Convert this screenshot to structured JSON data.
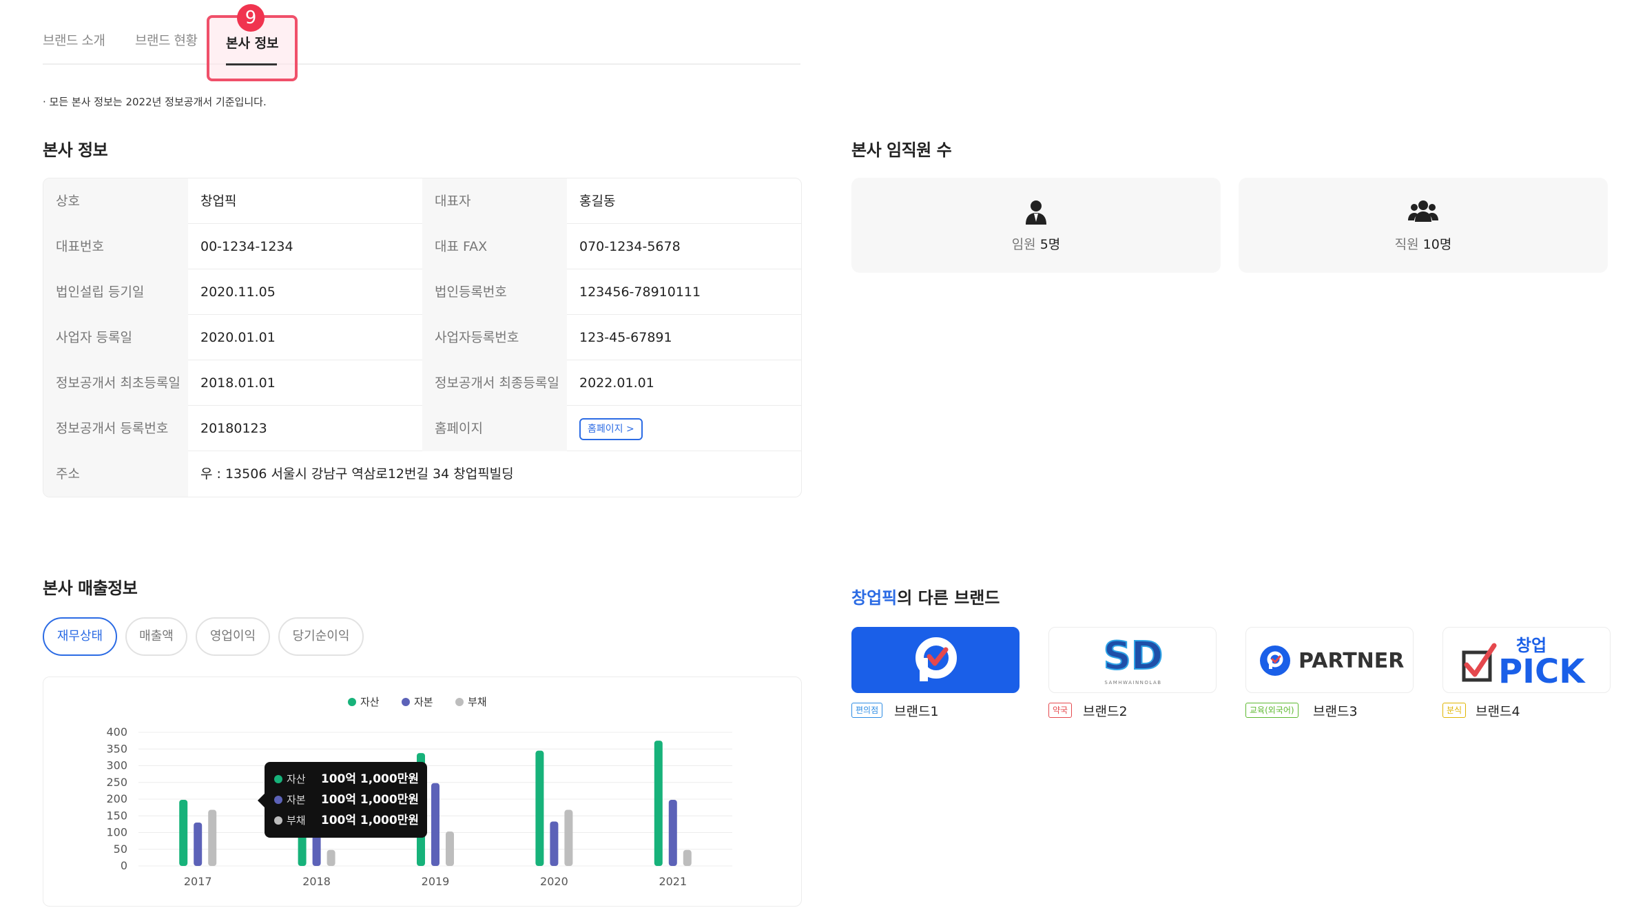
{
  "tabs": {
    "items": [
      {
        "label": "브랜드 소개"
      },
      {
        "label": "브랜드 현황"
      },
      {
        "label": "본사 정보"
      }
    ],
    "badge": "9"
  },
  "notice": "· 모든 본사 정보는 2022년 정보공개서 기준입니다.",
  "hq_info": {
    "title": "본사 정보",
    "rows": [
      {
        "label_a": "상호",
        "value_a": "창업픽",
        "label_b": "대표자",
        "value_b": "홍길동"
      },
      {
        "label_a": "대표번호",
        "value_a": "00-1234-1234",
        "label_b": "대표 FAX",
        "value_b": "070-1234-5678"
      },
      {
        "label_a": "법인설립 등기일",
        "value_a": "2020.11.05",
        "label_b": "법인등록번호",
        "value_b": "123456-78910111"
      },
      {
        "label_a": "사업자 등록일",
        "value_a": "2020.01.01",
        "label_b": "사업자등록번호",
        "value_b": "123-45-67891"
      },
      {
        "label_a": "정보공개서 최초등록일",
        "value_a": "2018.01.01",
        "label_b": "정보공개서 최종등록일",
        "value_b": "2022.01.01"
      },
      {
        "label_a": "정보공개서 등록번호",
        "value_a": "20180123",
        "label_b": "홈페이지",
        "value_b": "홈페이지 >"
      }
    ],
    "address_label": "주소",
    "address_value": "우 : 13506 서울시 강남구 역삼로12번길 34 창업픽빌딩"
  },
  "employees": {
    "title": "본사 임직원 수",
    "executives": {
      "label": "임원",
      "value": "5명",
      "icon": "executive-person-icon"
    },
    "staff": {
      "label": "직원",
      "value": "10명",
      "icon": "group-people-icon"
    }
  },
  "revenue": {
    "title": "본사 매출정보",
    "filters": [
      "재무상태",
      "매출액",
      "영업이익",
      "당기순이익"
    ],
    "active_filter": "재무상태",
    "tooltip": {
      "rows": [
        {
          "name": "자산",
          "value": "100억 1,000만원"
        },
        {
          "name": "자본",
          "value": "100억 1,000만원"
        },
        {
          "name": "부채",
          "value": "100억 1,000만원"
        }
      ]
    }
  },
  "chart_data": {
    "type": "bar",
    "categories": [
      "2017",
      "2018",
      "2019",
      "2020",
      "2021"
    ],
    "series": [
      {
        "name": "자산",
        "color": "#17b27a",
        "values": [
          198,
          150,
          338,
          345,
          375
        ]
      },
      {
        "name": "자본",
        "color": "#5c62b8",
        "values": [
          130,
          150,
          248,
          133,
          198
        ]
      },
      {
        "name": "부채",
        "color": "#bdbdbd",
        "values": [
          168,
          48,
          103,
          168,
          48
        ]
      }
    ],
    "ylim": [
      0,
      400
    ],
    "yticks": [
      "0",
      "50",
      "100",
      "150",
      "200",
      "250",
      "300",
      "350",
      "400"
    ],
    "legend_position": "top-center",
    "grid": true
  },
  "other_brands": {
    "title_accent": "창업픽",
    "title_rest": "의 다른 브랜드",
    "items": [
      {
        "tag": "편의점",
        "tag_color": "#2b8be4",
        "name": "브랜드1",
        "logo": "p-check-logo"
      },
      {
        "tag": "약국",
        "tag_color": "#e5484d",
        "name": "브랜드2",
        "logo": "sd-logo",
        "logo_text": "SD",
        "logo_sub": "SAMHWAINNOLAB"
      },
      {
        "tag": "교육(외국어)",
        "tag_color": "#5cb82e",
        "name": "브랜드3",
        "logo": "partner-logo",
        "logo_text": "PARTNER"
      },
      {
        "tag": "분식",
        "tag_color": "#e0b400",
        "name": "브랜드4",
        "logo": "changup-pick-logo",
        "logo_text_top": "창업",
        "logo_text": "PICK"
      }
    ]
  }
}
